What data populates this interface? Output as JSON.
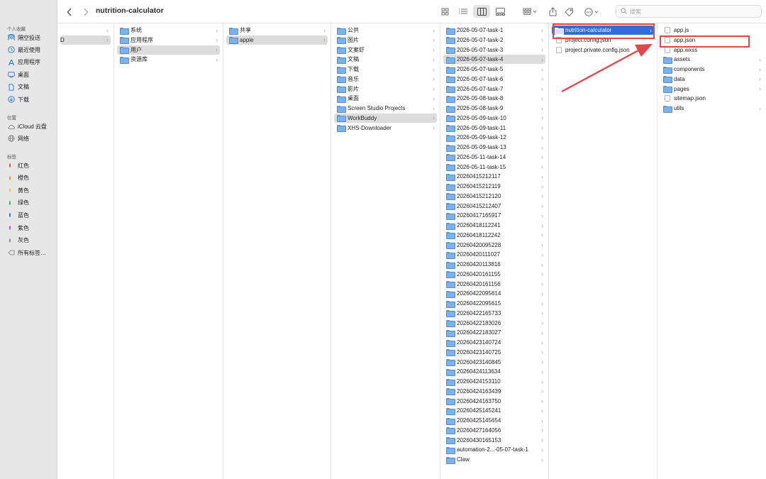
{
  "window": {
    "title": "nutrition-calculator"
  },
  "sidebar": {
    "favorites_title": "个人收藏",
    "favorites": [
      {
        "label": "隔空投送",
        "icon": "airdrop-icon"
      },
      {
        "label": "最近使用",
        "icon": "clock-icon"
      },
      {
        "label": "应用程序",
        "icon": "applications-icon"
      },
      {
        "label": "桌面",
        "icon": "desktop-icon"
      },
      {
        "label": "文稿",
        "icon": "document-icon"
      },
      {
        "label": "下载",
        "icon": "download-icon"
      }
    ],
    "locations_title": "位置",
    "locations": [
      {
        "label": "iCloud 云盘",
        "icon": "cloud-icon"
      },
      {
        "label": "网络",
        "icon": "globe-icon"
      }
    ],
    "tags_title": "标签",
    "tags": [
      {
        "label": "红色",
        "color": "#f0473f"
      },
      {
        "label": "橙色",
        "color": "#f5901f"
      },
      {
        "label": "黄色",
        "color": "#f5c31c"
      },
      {
        "label": "绿色",
        "color": "#30b94a"
      },
      {
        "label": "蓝色",
        "color": "#2a72df"
      },
      {
        "label": "紫色",
        "color": "#a24fd0"
      },
      {
        "label": "灰色",
        "color": "#8a8a8e"
      },
      {
        "label": "所有标签…",
        "color": ""
      }
    ]
  },
  "toolbar": {
    "back_icon": "chevron-left-icon",
    "forward_icon": "chevron-right-icon",
    "search_placeholder": "搜索"
  },
  "columns": [
    {
      "rows": [
        {
          "label": "",
          "type": "spacer",
          "chev": true
        },
        {
          "label": "D",
          "type": "truncated",
          "selected": "gray",
          "chev": true
        }
      ]
    },
    {
      "rows": [
        {
          "label": "系统",
          "type": "folder",
          "chev": true
        },
        {
          "label": "应用程序",
          "type": "folder",
          "chev": true
        },
        {
          "label": "用户",
          "type": "folder",
          "chev": true,
          "selected": "gray"
        },
        {
          "label": "资源库",
          "type": "folder",
          "chev": true
        }
      ]
    },
    {
      "rows": [
        {
          "label": "共享",
          "type": "folder",
          "chev": true
        },
        {
          "label": "apple",
          "type": "folder",
          "chev": true,
          "selected": "gray"
        }
      ]
    },
    {
      "rows": [
        {
          "label": "公共",
          "type": "folder",
          "chev": true
        },
        {
          "label": "图片",
          "type": "folder",
          "chev": true
        },
        {
          "label": "文案虾",
          "type": "folder",
          "chev": true
        },
        {
          "label": "文稿",
          "type": "folder",
          "chev": true
        },
        {
          "label": "下载",
          "type": "folder",
          "chev": true
        },
        {
          "label": "音乐",
          "type": "folder",
          "chev": true
        },
        {
          "label": "影片",
          "type": "folder",
          "chev": true
        },
        {
          "label": "桌面",
          "type": "folder",
          "chev": true
        },
        {
          "label": "Screen Studio Projects",
          "type": "folder",
          "chev": true
        },
        {
          "label": "WorkBuddy",
          "type": "folder",
          "chev": true,
          "selected": "gray"
        },
        {
          "label": "XHS-Downloader",
          "type": "folder",
          "chev": true
        }
      ]
    },
    {
      "rows": [
        {
          "label": "2026-05-07-task-1",
          "type": "folder",
          "chev": true
        },
        {
          "label": "2026-05-07-task-2",
          "type": "folder",
          "chev": true
        },
        {
          "label": "2026-05-07-task-3",
          "type": "folder",
          "chev": true
        },
        {
          "label": "2026-05-07-task-4",
          "type": "folder",
          "chev": true,
          "selected": "gray"
        },
        {
          "label": "2026-05-07-task-5",
          "type": "folder",
          "chev": true
        },
        {
          "label": "2026-05-07-task-6",
          "type": "folder",
          "chev": true
        },
        {
          "label": "2026-05-07-task-7",
          "type": "folder",
          "chev": true
        },
        {
          "label": "2026-05-08-task-8",
          "type": "folder",
          "chev": true
        },
        {
          "label": "2026-05-08-task-9",
          "type": "folder",
          "chev": true
        },
        {
          "label": "2026-05-09-task-10",
          "type": "folder",
          "chev": true
        },
        {
          "label": "2026-05-09-task-11",
          "type": "folder",
          "chev": true
        },
        {
          "label": "2026-05-09-task-12",
          "type": "folder",
          "chev": true
        },
        {
          "label": "2026-05-09-task-13",
          "type": "folder",
          "chev": true
        },
        {
          "label": "2026-05-11-task-14",
          "type": "folder",
          "chev": true
        },
        {
          "label": "2026-05-11-task-15",
          "type": "folder",
          "chev": true
        },
        {
          "label": "20260415212117",
          "type": "folder",
          "chev": true
        },
        {
          "label": "20260415212119",
          "type": "folder",
          "chev": true
        },
        {
          "label": "20260415212120",
          "type": "folder",
          "chev": true
        },
        {
          "label": "20260415212407",
          "type": "folder",
          "chev": true
        },
        {
          "label": "20260417165917",
          "type": "folder",
          "chev": true
        },
        {
          "label": "20260418112241",
          "type": "folder",
          "chev": true
        },
        {
          "label": "20260418112242",
          "type": "folder",
          "chev": true
        },
        {
          "label": "20260420095228",
          "type": "folder",
          "chev": true
        },
        {
          "label": "20260420111027",
          "type": "folder",
          "chev": true
        },
        {
          "label": "20260420113816",
          "type": "folder",
          "chev": true
        },
        {
          "label": "20260420161155",
          "type": "folder",
          "chev": true
        },
        {
          "label": "20260420161156",
          "type": "folder",
          "chev": true
        },
        {
          "label": "20260422095614",
          "type": "folder",
          "chev": true
        },
        {
          "label": "20260422095615",
          "type": "folder",
          "chev": true
        },
        {
          "label": "20260422165733",
          "type": "folder",
          "chev": true
        },
        {
          "label": "20260422183026",
          "type": "folder",
          "chev": true
        },
        {
          "label": "20260422183027",
          "type": "folder",
          "chev": true
        },
        {
          "label": "20260423140724",
          "type": "folder",
          "chev": true
        },
        {
          "label": "20260423140725",
          "type": "folder",
          "chev": true
        },
        {
          "label": "20260423140845",
          "type": "folder",
          "chev": true
        },
        {
          "label": "20260424113634",
          "type": "folder",
          "chev": true
        },
        {
          "label": "20260424153110",
          "type": "folder",
          "chev": true
        },
        {
          "label": "20260424163439",
          "type": "folder",
          "chev": true
        },
        {
          "label": "20260424163750",
          "type": "folder",
          "chev": true
        },
        {
          "label": "20260425145241",
          "type": "folder",
          "chev": true
        },
        {
          "label": "20260425145654",
          "type": "folder",
          "chev": true
        },
        {
          "label": "20260427164056",
          "type": "folder",
          "chev": true
        },
        {
          "label": "20260430165153",
          "type": "folder",
          "chev": true
        },
        {
          "label": "automation-2...-05-07-task-1",
          "type": "folder",
          "chev": true
        },
        {
          "label": "Claw",
          "type": "folder",
          "chev": true
        }
      ]
    },
    {
      "rows": [
        {
          "label": "nutrition-calculator",
          "type": "folder",
          "chev": true,
          "selected": "blue"
        },
        {
          "label": "project.config.json",
          "type": "file",
          "chev": false
        },
        {
          "label": "project.private.config.json",
          "type": "file",
          "chev": false
        }
      ]
    },
    {
      "rows": [
        {
          "label": "app.js",
          "type": "file",
          "chev": false
        },
        {
          "label": "app.json",
          "type": "file",
          "chev": false
        },
        {
          "label": "app.wxss",
          "type": "file",
          "chev": false
        },
        {
          "label": "assets",
          "type": "folder",
          "chev": true
        },
        {
          "label": "components",
          "type": "folder",
          "chev": true
        },
        {
          "label": "data",
          "type": "folder",
          "chev": true
        },
        {
          "label": "pages",
          "type": "folder",
          "chev": true
        },
        {
          "label": "sitemap.json",
          "type": "file",
          "chev": false
        },
        {
          "label": "utils",
          "type": "folder",
          "chev": true
        }
      ]
    }
  ],
  "annotation": {
    "color": "#e6454a"
  }
}
